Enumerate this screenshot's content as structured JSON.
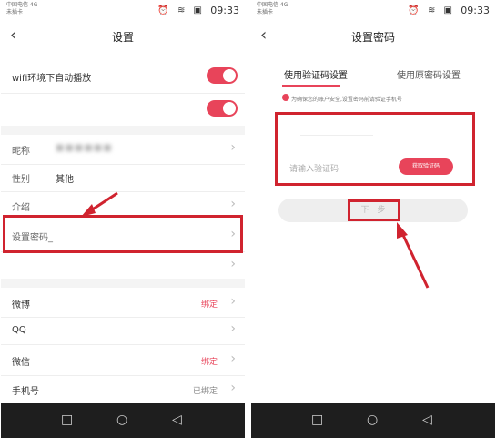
{
  "left": {
    "status": {
      "carrier": [
        "中国电信 4G",
        "未插卡"
      ],
      "icons": "⏰ ≋ ▣",
      "time": "09:33"
    },
    "title": "设置",
    "autoplay_label": "wifi环境下自动播放",
    "profile": {
      "nickname_label": "昵称",
      "nickname_value": "■■■■■■",
      "gender_label": "性别",
      "gender_value": "其他",
      "intro_label": "介绍",
      "password_label": "设置密码_"
    },
    "bindings": [
      {
        "label": "微博",
        "status": "绑定"
      },
      {
        "label": "QQ",
        "status": ""
      },
      {
        "label": "微信",
        "status": "绑定"
      },
      {
        "label": "手机号",
        "status": "已绑定"
      }
    ]
  },
  "right": {
    "status": {
      "carrier": [
        "中国电信 4G",
        "未插卡"
      ],
      "icons": "⏰ ≋ ▣",
      "time": "09:33"
    },
    "title": "设置密码",
    "tabs": [
      "使用验证码设置",
      "使用原密码设置"
    ],
    "hint": "为确保您的账户安全,设置密码前请验证手机号",
    "code_placeholder": "请输入验证码",
    "get_code_label": "获取验证码",
    "next_label": "下一步"
  },
  "colors": {
    "accent": "#e8445a",
    "highlight": "#d0232f"
  }
}
